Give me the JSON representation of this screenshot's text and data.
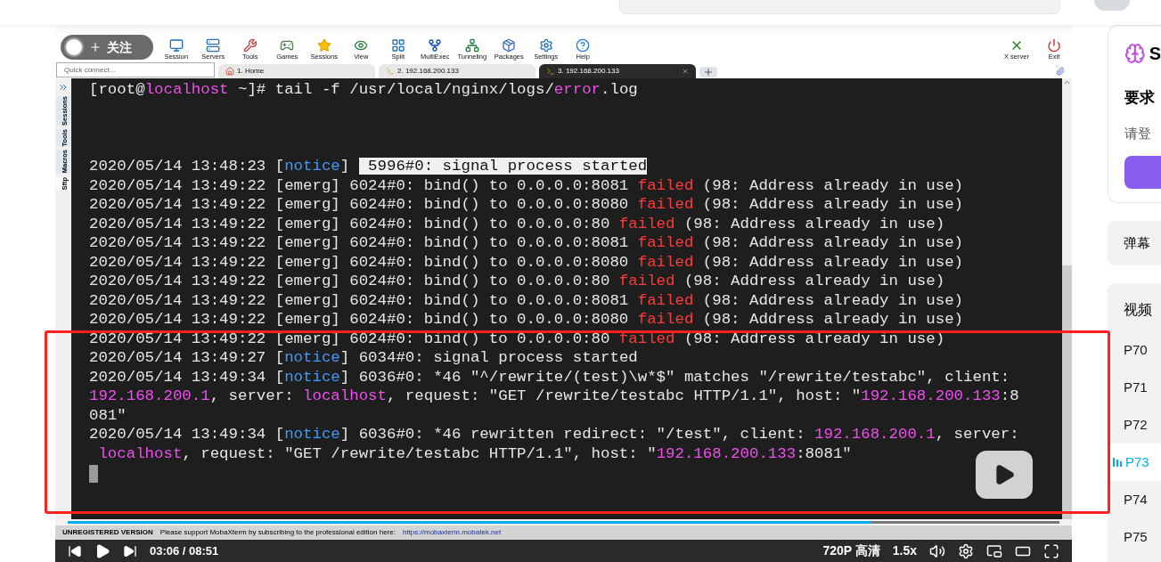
{
  "follow_button": {
    "label": "关注"
  },
  "toolbar": [
    "Session",
    "Servers",
    "Tools",
    "Games",
    "Sessions",
    "View",
    "Split",
    "MultiExec",
    "Tunneling",
    "Packages",
    "Settings",
    "Help"
  ],
  "toolbar_right": [
    "X server",
    "Exit"
  ],
  "quick_connect": {
    "placeholder": "Quick connect..."
  },
  "tabs": [
    {
      "label": "1. Home",
      "selected": false,
      "kind": "home"
    },
    {
      "label": "2. 192.168.200.133",
      "selected": false,
      "kind": "ssh"
    },
    {
      "label": "3. 192.168.200.133",
      "selected": true,
      "kind": "ssh"
    }
  ],
  "side_tabs": [
    {
      "label": "Sessions",
      "selected": false
    },
    {
      "label": "Tools",
      "selected": false
    },
    {
      "label": "Macros",
      "selected": false
    },
    {
      "label": "Sftp",
      "selected": true
    }
  ],
  "terminal": {
    "cursor": true,
    "lines": [
      {
        "kind": "text",
        "segments": [
          {
            "text": "[root@",
            "kind": "plain"
          },
          {
            "text": "localhost",
            "kind": "accent"
          },
          {
            "text": " ~]# tail -f /usr/local/nginx/logs/",
            "kind": "plain"
          },
          {
            "text": "error",
            "kind": "accent"
          },
          {
            "text": ".log",
            "kind": "plain"
          }
        ]
      },
      {
        "kind": "blank"
      },
      {
        "kind": "blank"
      },
      {
        "kind": "blank"
      },
      {
        "kind": "text",
        "segments": [
          {
            "text": "2020/05/14 13:48:23 [",
            "kind": "plain"
          },
          {
            "text": "notice",
            "kind": "info"
          },
          {
            "text": "] ",
            "kind": "plain"
          },
          {
            "text": " 5996#0: signal process started",
            "kind": "highlight"
          }
        ]
      },
      {
        "kind": "text",
        "segments": [
          {
            "text": "2020/05/14 13:49:22 [emerg] 6024#0: bind() to 0.0.0.0:8081 ",
            "kind": "plain"
          },
          {
            "text": "failed",
            "kind": "error"
          },
          {
            "text": " (98: Address already in use)",
            "kind": "plain"
          }
        ]
      },
      {
        "kind": "text",
        "segments": [
          {
            "text": "2020/05/14 13:49:22 [emerg] 6024#0: bind() to 0.0.0.0:8080 ",
            "kind": "plain"
          },
          {
            "text": "failed",
            "kind": "error"
          },
          {
            "text": " (98: Address already in use)",
            "kind": "plain"
          }
        ]
      },
      {
        "kind": "text",
        "segments": [
          {
            "text": "2020/05/14 13:49:22 [emerg] 6024#0: bind() to 0.0.0.0:80 ",
            "kind": "plain"
          },
          {
            "text": "failed",
            "kind": "error"
          },
          {
            "text": " (98: Address already in use)",
            "kind": "plain"
          }
        ]
      },
      {
        "kind": "text",
        "segments": [
          {
            "text": "2020/05/14 13:49:22 [emerg] 6024#0: bind() to 0.0.0.0:8081 ",
            "kind": "plain"
          },
          {
            "text": "failed",
            "kind": "error"
          },
          {
            "text": " (98: Address already in use)",
            "kind": "plain"
          }
        ]
      },
      {
        "kind": "text",
        "segments": [
          {
            "text": "2020/05/14 13:49:22 [emerg] 6024#0: bind() to 0.0.0.0:8080 ",
            "kind": "plain"
          },
          {
            "text": "failed",
            "kind": "error"
          },
          {
            "text": " (98: Address already in use)",
            "kind": "plain"
          }
        ]
      },
      {
        "kind": "text",
        "segments": [
          {
            "text": "2020/05/14 13:49:22 [emerg] 6024#0: bind() to 0.0.0.0:80 ",
            "kind": "plain"
          },
          {
            "text": "failed",
            "kind": "error"
          },
          {
            "text": " (98: Address already in use)",
            "kind": "plain"
          }
        ]
      },
      {
        "kind": "text",
        "segments": [
          {
            "text": "2020/05/14 13:49:22 [emerg] 6024#0: bind() to 0.0.0.0:8081 ",
            "kind": "plain"
          },
          {
            "text": "failed",
            "kind": "error"
          },
          {
            "text": " (98: Address already in use)",
            "kind": "plain"
          }
        ]
      },
      {
        "kind": "text",
        "segments": [
          {
            "text": "2020/05/14 13:49:22 [emerg] 6024#0: bind() to 0.0.0.0:8080 ",
            "kind": "plain"
          },
          {
            "text": "failed",
            "kind": "error"
          },
          {
            "text": " (98: Address already in use)",
            "kind": "plain"
          }
        ]
      },
      {
        "kind": "text",
        "segments": [
          {
            "text": "2020/05/14 13:49:22 [emerg] 6024#0: bind() to 0.0.0.0:80 ",
            "kind": "plain"
          },
          {
            "text": "failed",
            "kind": "error"
          },
          {
            "text": " (98: Address already in use)",
            "kind": "plain"
          }
        ]
      },
      {
        "kind": "text",
        "segments": [
          {
            "text": "2020/05/14 13:49:27 [",
            "kind": "plain"
          },
          {
            "text": "notice",
            "kind": "info"
          },
          {
            "text": "] 6034#0: signal process started",
            "kind": "plain"
          }
        ]
      },
      {
        "kind": "text",
        "segments": [
          {
            "text": "2020/05/14 13:49:34 [",
            "kind": "plain"
          },
          {
            "text": "notice",
            "kind": "info"
          },
          {
            "text": "] 6036#0: *46 \"^/rewrite/(test)\\w*$\" matches \"/rewrite/testabc\", client:",
            "kind": "plain"
          }
        ]
      },
      {
        "kind": "text",
        "segments": [
          {
            "text": "192.168.200.1",
            "kind": "accent"
          },
          {
            "text": ", server: ",
            "kind": "plain"
          },
          {
            "text": "localhost",
            "kind": "accent"
          },
          {
            "text": ", request: \"GET /rewrite/testabc HTTP/1.1\", host: \"",
            "kind": "plain"
          },
          {
            "text": "192.168.200.133",
            "kind": "accent"
          },
          {
            "text": ":8",
            "kind": "plain"
          }
        ]
      },
      {
        "kind": "text",
        "segments": [
          {
            "text": "081\"",
            "kind": "plain"
          }
        ]
      },
      {
        "kind": "text",
        "segments": [
          {
            "text": "2020/05/14 13:49:34 [",
            "kind": "plain"
          },
          {
            "text": "notice",
            "kind": "info"
          },
          {
            "text": "] 6036#0: *46 rewritten redirect: \"/test\", client: ",
            "kind": "plain"
          },
          {
            "text": "192.168.200.1",
            "kind": "accent"
          },
          {
            "text": ", server:",
            "kind": "plain"
          }
        ]
      },
      {
        "kind": "text",
        "segments": [
          {
            "text": " localhost",
            "kind": "accent"
          },
          {
            "text": ", request: \"GET /rewrite/testabc HTTP/1.1\", host: \"",
            "kind": "plain"
          },
          {
            "text": "192.168.200.133",
            "kind": "accent"
          },
          {
            "text": ":8081\"",
            "kind": "plain"
          }
        ]
      }
    ]
  },
  "status": {
    "label": "UNREGISTERED VERSION",
    "text": "Please support MobaXterm by subscribing to the professional edition here:",
    "link": "https://mobaxterm.mobatek.net"
  },
  "player": {
    "level": 0.81,
    "time": "03:06 / 08:51",
    "quality": "720P 高清",
    "speed": "1.5x"
  },
  "side": {
    "brand": "S",
    "login_title": "要求",
    "login_text": "请登",
    "danmaku": "弹幕",
    "playlist": {
      "title": "视频",
      "items": [
        {
          "label": "P70",
          "selected": false
        },
        {
          "label": "P71",
          "selected": false
        },
        {
          "label": "P72",
          "selected": false
        },
        {
          "label": "P73",
          "selected": true
        },
        {
          "label": "P74",
          "selected": false
        },
        {
          "label": "P75",
          "selected": false
        }
      ]
    }
  }
}
